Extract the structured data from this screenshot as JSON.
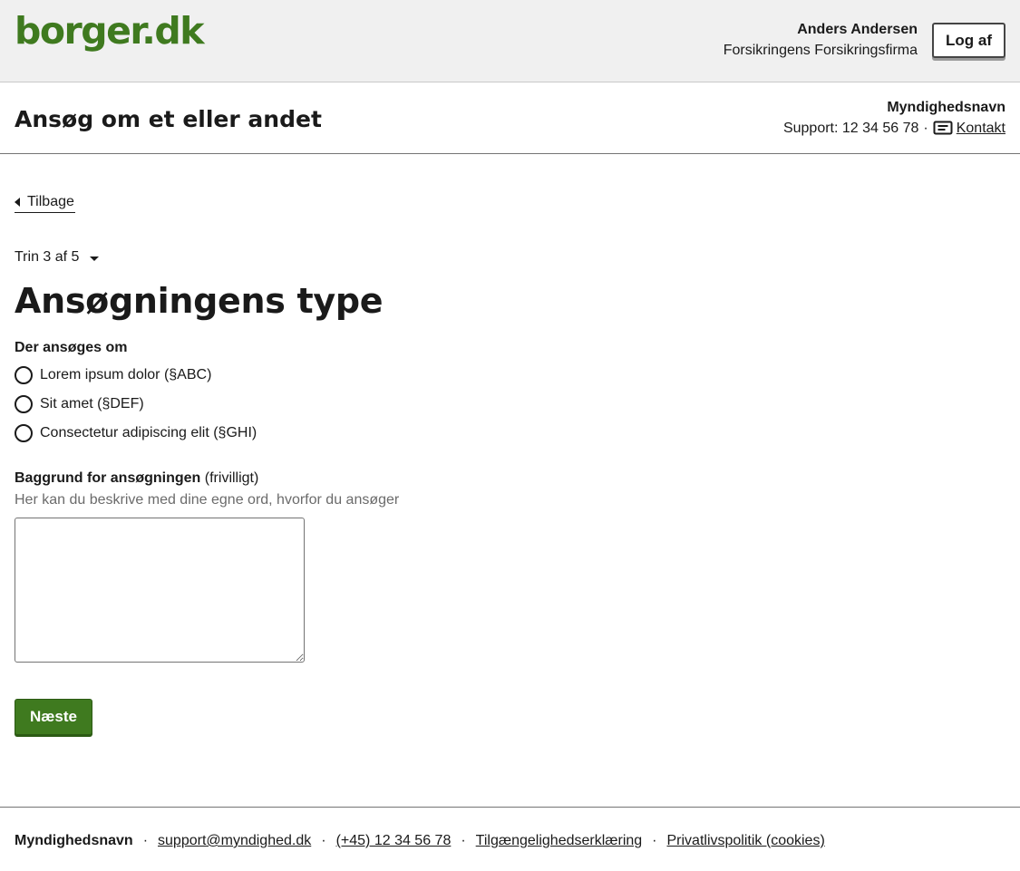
{
  "portal_header": {
    "logo_text": "borger.dk",
    "user_name": "Anders Andersen",
    "user_org": "Forsikringens Forsikringsfirma",
    "logout_label": "Log af"
  },
  "solution_header": {
    "title": "Ansøg om et eller andet",
    "authority_name": "Myndighedsnavn",
    "support_text": "Support: 12 34 56 78",
    "separator": "·",
    "contact_label": "Kontakt"
  },
  "main": {
    "back_label": "Tilbage",
    "step_indicator": "Trin 3 af 5",
    "page_title": "Ansøgningens type",
    "radio_legend": "Der ansøges om",
    "radio_options": [
      {
        "label": "Lorem ipsum dolor (§ABC)",
        "selected": false
      },
      {
        "label": "Sit amet (§DEF)",
        "selected": false
      },
      {
        "label": "Consectetur adipiscing elit (§GHI)",
        "selected": false
      }
    ],
    "textarea_label": "Baggrund for ansøgningen",
    "textarea_optional": "(frivilligt)",
    "textarea_hint": "Her kan du beskrive med dine egne ord, hvorfor du ansøger",
    "textarea_value": "",
    "next_label": "Næste"
  },
  "footer": {
    "authority_name": "Myndighedsnavn",
    "separator": "·",
    "links": [
      "support@myndighed.dk",
      "(+45) 12 34 56 78",
      "Tilgængelighedserklæring",
      "Privatlivspolitik (cookies)"
    ]
  },
  "colors": {
    "brand_green": "#3f7a1f",
    "header_bg": "#f0f0f0",
    "text": "#1a1a1a",
    "hint": "#6b6b6b"
  }
}
